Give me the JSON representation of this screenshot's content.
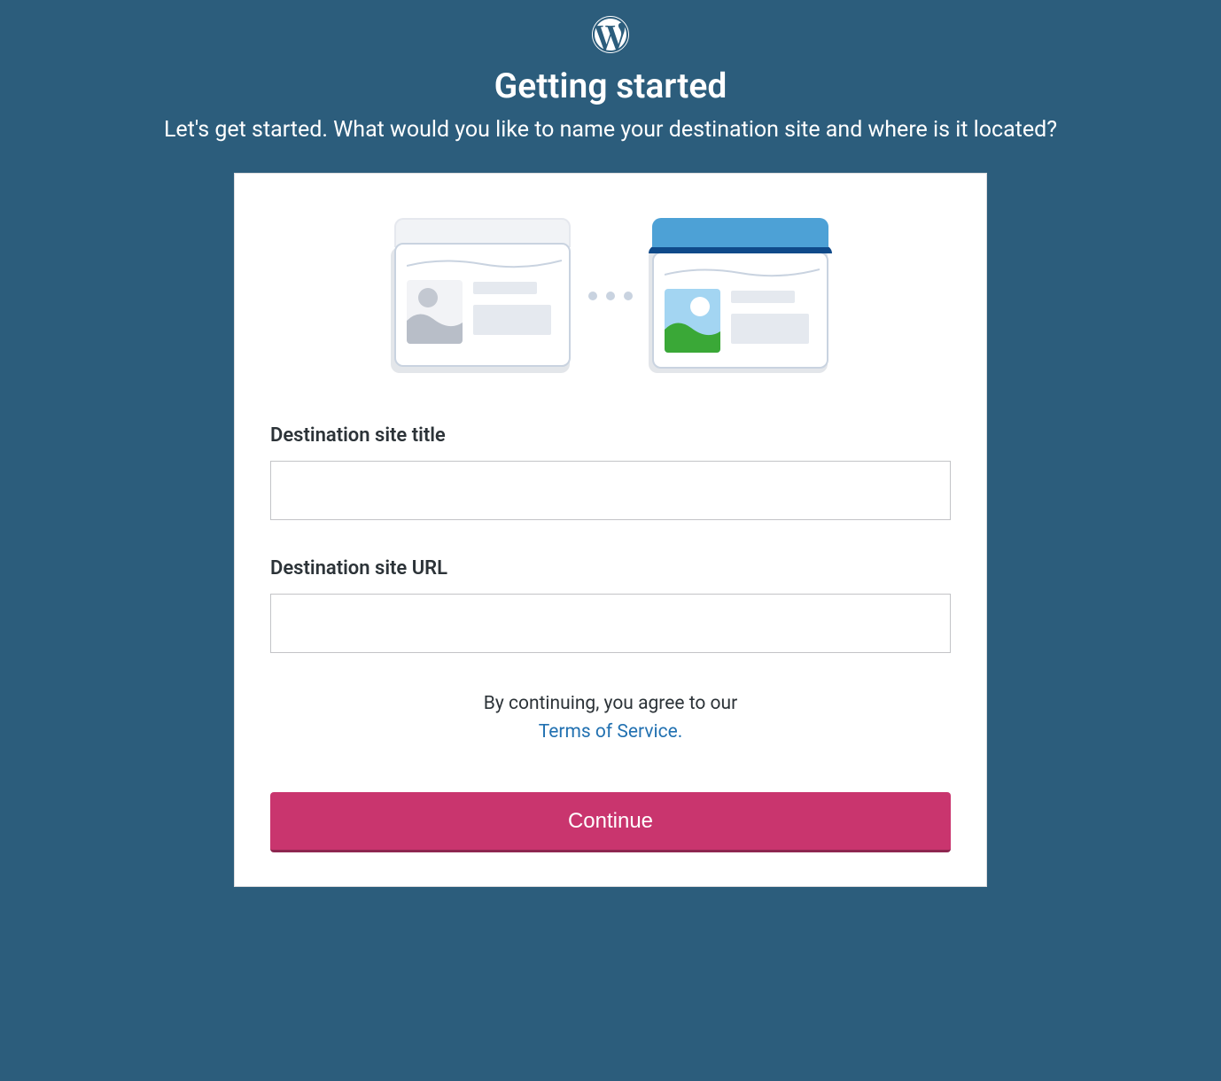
{
  "header": {
    "title": "Getting started",
    "subtitle": "Let's get started. What would you like to name your destination site and where is it located?"
  },
  "form": {
    "title_label": "Destination site title",
    "title_value": "",
    "url_label": "Destination site URL",
    "url_value": ""
  },
  "agreement": {
    "prefix": "By continuing, you agree to our ",
    "link_text": "Terms of Service.",
    "link_color": "#2271b1"
  },
  "actions": {
    "continue_label": "Continue"
  },
  "colors": {
    "page_bg": "#2c5d7c",
    "button_bg": "#c9356e",
    "button_border": "#8e2650"
  }
}
